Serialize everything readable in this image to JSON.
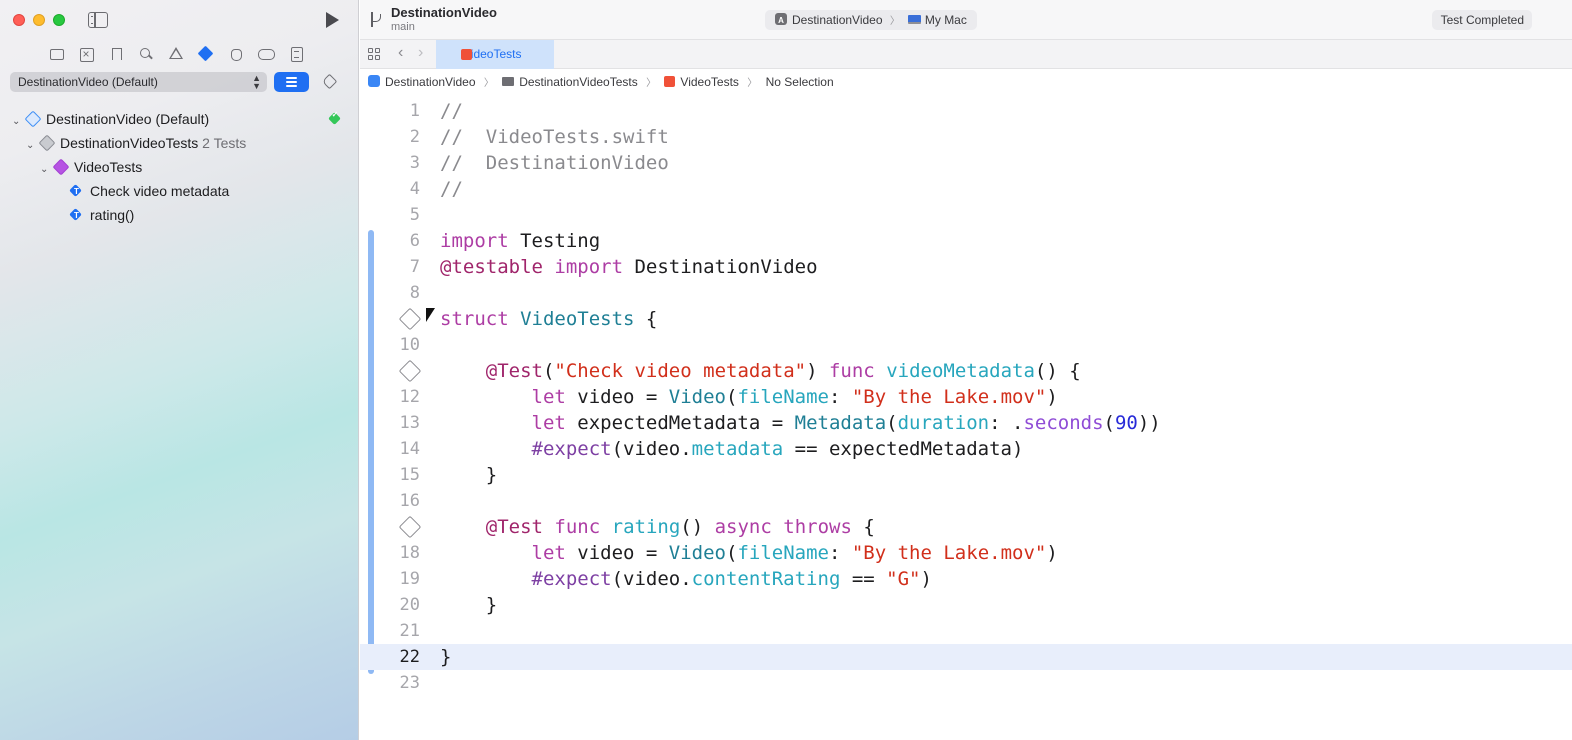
{
  "sidebar": {
    "scheme_selector": "DestinationVideo (Default)",
    "navigator_icons": [
      "folder-icon",
      "source-control-icon",
      "bookmark-icon",
      "search-icon",
      "warning-icon",
      "test-icon",
      "debug-icon",
      "breakpoint-icon",
      "report-icon"
    ],
    "tree": {
      "root": {
        "label": "DestinationVideo (Default)",
        "status": "passed"
      },
      "bundle": {
        "label": "DestinationVideoTests",
        "count": "2 Tests"
      },
      "suite": {
        "label": "VideoTests"
      },
      "tests": [
        {
          "label": "Check video metadata"
        },
        {
          "label": "rating()"
        }
      ]
    }
  },
  "toolbar": {
    "project": "DestinationVideo",
    "branch": "main",
    "scheme": "DestinationVideo",
    "destination": "My Mac",
    "status": "Test Completed"
  },
  "tabs": [
    {
      "label": "VideoTests",
      "active": true
    }
  ],
  "breadcrumbs": [
    "DestinationVideo",
    "DestinationVideoTests",
    "VideoTests",
    "No Selection"
  ],
  "editor": {
    "current_line": 22,
    "lines": [
      {
        "n": "1",
        "tokens": [
          [
            "comment",
            "//"
          ]
        ]
      },
      {
        "n": "2",
        "tokens": [
          [
            "comment",
            "//  VideoTests.swift"
          ]
        ]
      },
      {
        "n": "3",
        "tokens": [
          [
            "comment",
            "//  DestinationVideo"
          ]
        ]
      },
      {
        "n": "4",
        "tokens": [
          [
            "comment",
            "//"
          ]
        ]
      },
      {
        "n": "5",
        "tokens": []
      },
      {
        "n": "6",
        "tokens": [
          [
            "kw",
            "import"
          ],
          [
            "plain",
            " Testing"
          ]
        ]
      },
      {
        "n": "7",
        "tokens": [
          [
            "attr",
            "@testable"
          ],
          [
            "plain",
            " "
          ],
          [
            "kw",
            "import"
          ],
          [
            "plain",
            " DestinationVideo"
          ]
        ]
      },
      {
        "n": "8",
        "tokens": []
      },
      {
        "n": "",
        "diamond": true,
        "tokens": [
          [
            "kw",
            "struct"
          ],
          [
            "plain",
            " "
          ],
          [
            "type",
            "VideoTests"
          ],
          [
            "plain",
            " {"
          ]
        ]
      },
      {
        "n": "10",
        "tokens": []
      },
      {
        "n": "",
        "diamond": true,
        "tokens": [
          [
            "plain",
            "    "
          ],
          [
            "attr",
            "@Test"
          ],
          [
            "plain",
            "("
          ],
          [
            "str",
            "\"Check video metadata\""
          ],
          [
            "plain",
            ") "
          ],
          [
            "kw",
            "func"
          ],
          [
            "plain",
            " "
          ],
          [
            "fn",
            "videoMetadata"
          ],
          [
            "plain",
            "() {"
          ]
        ]
      },
      {
        "n": "12",
        "tokens": [
          [
            "plain",
            "        "
          ],
          [
            "kw",
            "let"
          ],
          [
            "plain",
            " video = "
          ],
          [
            "type",
            "Video"
          ],
          [
            "plain",
            "("
          ],
          [
            "prop",
            "fileName"
          ],
          [
            "plain",
            ": "
          ],
          [
            "str",
            "\"By the Lake.mov\""
          ],
          [
            "plain",
            ")"
          ]
        ]
      },
      {
        "n": "13",
        "tokens": [
          [
            "plain",
            "        "
          ],
          [
            "kw",
            "let"
          ],
          [
            "plain",
            " expectedMetadata = "
          ],
          [
            "type",
            "Metadata"
          ],
          [
            "plain",
            "("
          ],
          [
            "prop",
            "duration"
          ],
          [
            "plain",
            ": ."
          ],
          [
            "enum",
            "seconds"
          ],
          [
            "plain",
            "("
          ],
          [
            "num",
            "90"
          ],
          [
            "plain",
            "))"
          ]
        ]
      },
      {
        "n": "14",
        "tokens": [
          [
            "plain",
            "        "
          ],
          [
            "macro",
            "#expect"
          ],
          [
            "plain",
            "(video."
          ],
          [
            "prop",
            "metadata"
          ],
          [
            "plain",
            " == expectedMetadata)"
          ]
        ]
      },
      {
        "n": "15",
        "tokens": [
          [
            "plain",
            "    }"
          ]
        ]
      },
      {
        "n": "16",
        "tokens": []
      },
      {
        "n": "",
        "diamond": true,
        "tokens": [
          [
            "plain",
            "    "
          ],
          [
            "attr",
            "@Test"
          ],
          [
            "plain",
            " "
          ],
          [
            "kw",
            "func"
          ],
          [
            "plain",
            " "
          ],
          [
            "fn",
            "rating"
          ],
          [
            "plain",
            "() "
          ],
          [
            "kw",
            "async"
          ],
          [
            "plain",
            " "
          ],
          [
            "kw",
            "throws"
          ],
          [
            "plain",
            " {"
          ]
        ]
      },
      {
        "n": "18",
        "tokens": [
          [
            "plain",
            "        "
          ],
          [
            "kw",
            "let"
          ],
          [
            "plain",
            " video = "
          ],
          [
            "type",
            "Video"
          ],
          [
            "plain",
            "("
          ],
          [
            "prop",
            "fileName"
          ],
          [
            "plain",
            ": "
          ],
          [
            "str",
            "\"By the Lake.mov\""
          ],
          [
            "plain",
            ")"
          ]
        ]
      },
      {
        "n": "19",
        "tokens": [
          [
            "plain",
            "        "
          ],
          [
            "macro",
            "#expect"
          ],
          [
            "plain",
            "(video."
          ],
          [
            "prop",
            "contentRating"
          ],
          [
            "plain",
            " == "
          ],
          [
            "str",
            "\"G\""
          ],
          [
            "plain",
            ")"
          ]
        ]
      },
      {
        "n": "20",
        "tokens": [
          [
            "plain",
            "    }"
          ]
        ]
      },
      {
        "n": "21",
        "tokens": []
      },
      {
        "n": "22",
        "tokens": [
          [
            "plain",
            "}"
          ]
        ]
      },
      {
        "n": "23",
        "tokens": []
      }
    ]
  },
  "colors": {
    "accent": "#1f6ff2",
    "keyword": "#ad3da4",
    "string": "#d12f1b",
    "type": "#1f7f95",
    "comment": "#8a8a8e",
    "number": "#272ad8"
  }
}
